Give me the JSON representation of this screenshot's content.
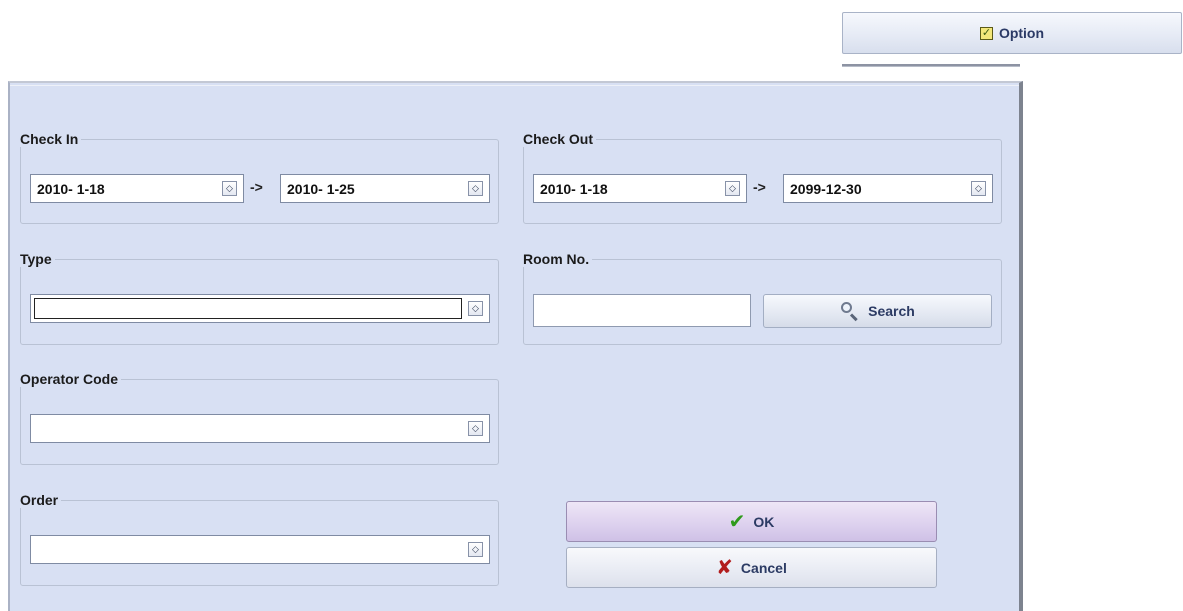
{
  "option_button": {
    "label": "Option",
    "icon": "checklist-icon"
  },
  "check_in": {
    "legend": "Check In",
    "from": "2010- 1-18",
    "to": "2010- 1-25",
    "arrow": "->"
  },
  "check_out": {
    "legend": "Check Out",
    "from": "2010- 1-18",
    "to": "2099-12-30",
    "arrow": "->"
  },
  "type": {
    "legend": "Type",
    "value": ""
  },
  "room_no": {
    "legend": "Room No.",
    "value": "",
    "search_label": "Search",
    "search_icon": "magnifier-icon"
  },
  "operator_code": {
    "legend": "Operator Code",
    "value": ""
  },
  "order": {
    "legend": "Order",
    "value": ""
  },
  "actions": {
    "ok_label": "OK",
    "ok_icon": "checkmark-icon",
    "cancel_label": "Cancel",
    "cancel_icon": "x-icon"
  },
  "colors": {
    "panel_bg": "#d8e0f3",
    "ok_check": "#2f9a1d",
    "cancel_x": "#b21d1d"
  }
}
